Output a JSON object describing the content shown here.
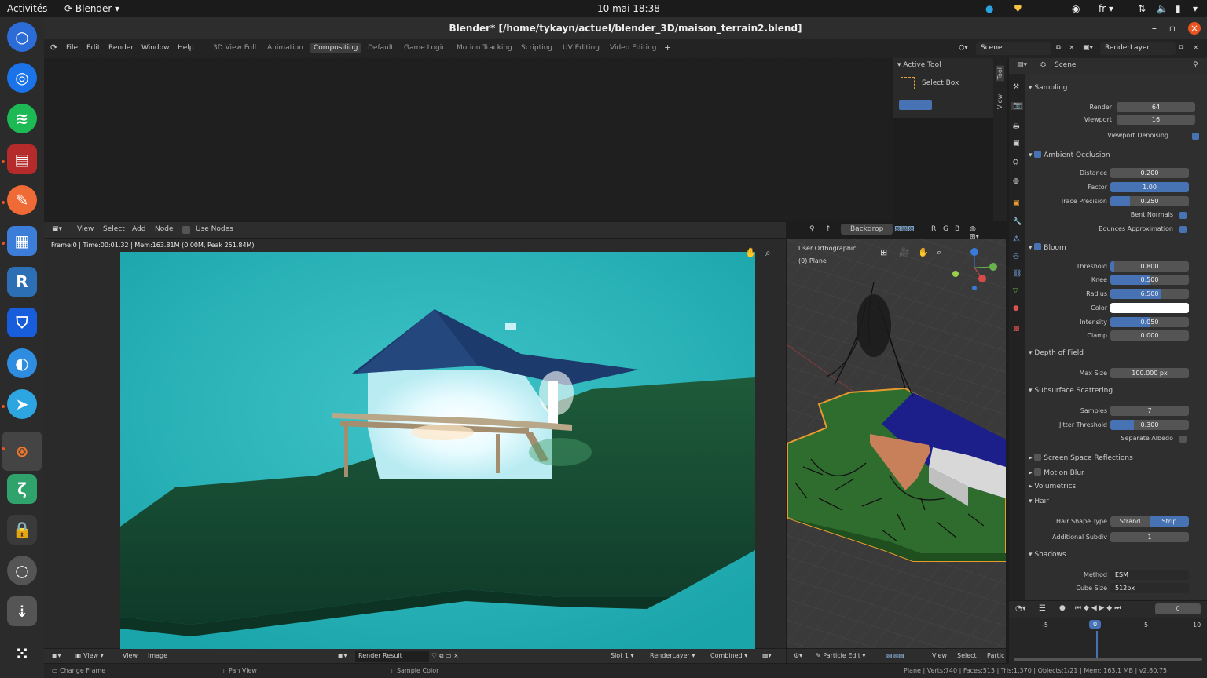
{
  "topbar": {
    "activities": "Activités",
    "app": "Blender ▾",
    "clock": "10 mai  18:38",
    "lang": "fr ▾"
  },
  "window": {
    "title": "Blender* [/home/tykayn/actuel/blender_3D/maison_terrain2.blend]"
  },
  "menu": [
    "File",
    "Edit",
    "Render",
    "Window",
    "Help"
  ],
  "workspaces": [
    "3D View Full",
    "Animation",
    "Compositing",
    "Default",
    "Game Logic",
    "Motion Tracking",
    "Scripting",
    "UV Editing",
    "Video Editing"
  ],
  "active_workspace": "Compositing",
  "scene_field": "Scene",
  "renderlayer_field": "RenderLayer",
  "tool": {
    "header": "Active Tool",
    "select": "Select Box"
  },
  "vtabs": [
    "Tool",
    "View"
  ],
  "node_header": {
    "view": "View",
    "select": "Select",
    "add": "Add",
    "node": "Node",
    "use_nodes": "Use Nodes",
    "backdrop": "Backdrop",
    "rgb": [
      "R",
      "G",
      "B"
    ]
  },
  "render_info": "Frame:0 | Time:00:01.32 | Mem:163.81M (0.00M, Peak 251.84M)",
  "viewport": {
    "title": "User Orthographic",
    "obj": "(0) Plane"
  },
  "image_footer": {
    "view": "View",
    "view2": "View",
    "image": "Image",
    "result": "Render Result",
    "slot": "Slot 1",
    "layer": "RenderLayer",
    "pass": "Combined"
  },
  "vp_footer": {
    "mode": "Particle Edit",
    "view": "View",
    "select": "Select",
    "partic": "Partic"
  },
  "status": {
    "left": "Change Frame",
    "mid": "Pan View",
    "right": "Sample Color",
    "stats": "Plane | Verts:740 | Faces:515 | Tris:1,370 | Objects:1/21 | Mem: 163.1 MB | v2.80.75"
  },
  "props": {
    "header": "Scene",
    "sampling": "Sampling",
    "render_l": "Render",
    "render_v": "64",
    "viewport_l": "Viewport",
    "viewport_v": "16",
    "denoise": "Viewport Denoising",
    "ao": "Ambient Occlusion",
    "distance_l": "Distance",
    "distance_v": "0.200",
    "factor_l": "Factor",
    "factor_v": "1.00",
    "trace_l": "Trace Precision",
    "trace_v": "0.250",
    "bent": "Bent Normals",
    "bounces": "Bounces Approximation",
    "bloom": "Bloom",
    "threshold_l": "Threshold",
    "threshold_v": "0.800",
    "knee_l": "Knee",
    "knee_v": "0.500",
    "radius_l": "Radius",
    "radius_v": "6.500",
    "color_l": "Color",
    "intensity_l": "Intensity",
    "intensity_v": "0.050",
    "clamp_l": "Clamp",
    "clamp_v": "0.000",
    "dof": "Depth of Field",
    "maxsize_l": "Max Size",
    "maxsize_v": "100.000 px",
    "sss": "Subsurface Scattering",
    "samples_l": "Samples",
    "samples_v": "7",
    "jitter_l": "Jitter Threshold",
    "jitter_v": "0.300",
    "sep": "Separate Albedo",
    "ssr": "Screen Space Reflections",
    "mblur": "Motion Blur",
    "volumetrics": "Volumetrics",
    "hair": "Hair",
    "hairshape_l": "Hair Shape Type",
    "strand": "Strand",
    "strip": "Strip",
    "addsub_l": "Additional Subdiv",
    "addsub_v": "1",
    "shadows": "Shadows",
    "method_l": "Method",
    "method_v": "ESM",
    "cube_l": "Cube Size",
    "cube_v": "512px"
  },
  "fills": {
    "factor": 1.0,
    "trace": 0.25,
    "threshold": 0.05,
    "knee": 0.5,
    "radius": 0.65,
    "intensity": 0.5,
    "jitter": 0.3
  },
  "timeline": {
    "frame": "0",
    "ticks": [
      "-5",
      "0",
      "5",
      "10"
    ]
  }
}
